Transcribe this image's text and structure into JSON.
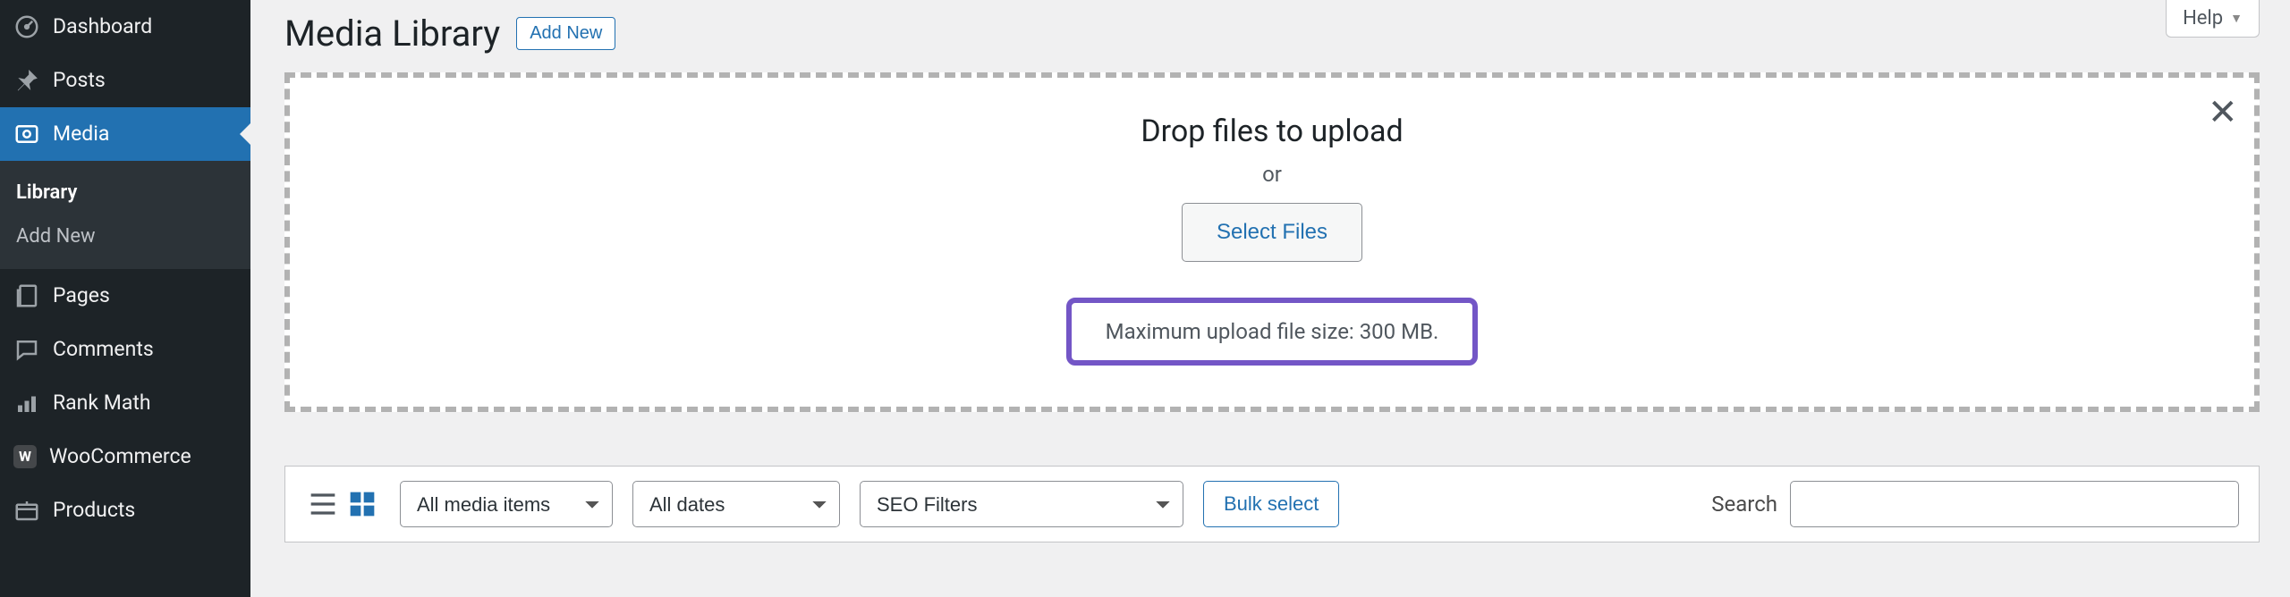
{
  "sidebar": {
    "items": [
      {
        "label": "Dashboard"
      },
      {
        "label": "Posts"
      },
      {
        "label": "Media"
      },
      {
        "label": "Pages"
      },
      {
        "label": "Comments"
      },
      {
        "label": "Rank Math"
      },
      {
        "label": "WooCommerce"
      },
      {
        "label": "Products"
      }
    ],
    "submenu": [
      {
        "label": "Library"
      },
      {
        "label": "Add New"
      }
    ]
  },
  "header": {
    "page_title": "Media Library",
    "add_new": "Add New",
    "help": "Help"
  },
  "uploader": {
    "drop_text": "Drop files to upload",
    "or_text": "or",
    "select_files_label": "Select Files",
    "max_size_text": "Maximum upload file size: 300 MB."
  },
  "filters": {
    "media_type": "All media items",
    "dates": "All dates",
    "seo": "SEO Filters",
    "bulk_select": "Bulk select",
    "search_label": "Search"
  },
  "icons": {
    "woo_badge": "W"
  },
  "colors": {
    "accent": "#2271b1",
    "highlight_border": "#7356c6"
  }
}
